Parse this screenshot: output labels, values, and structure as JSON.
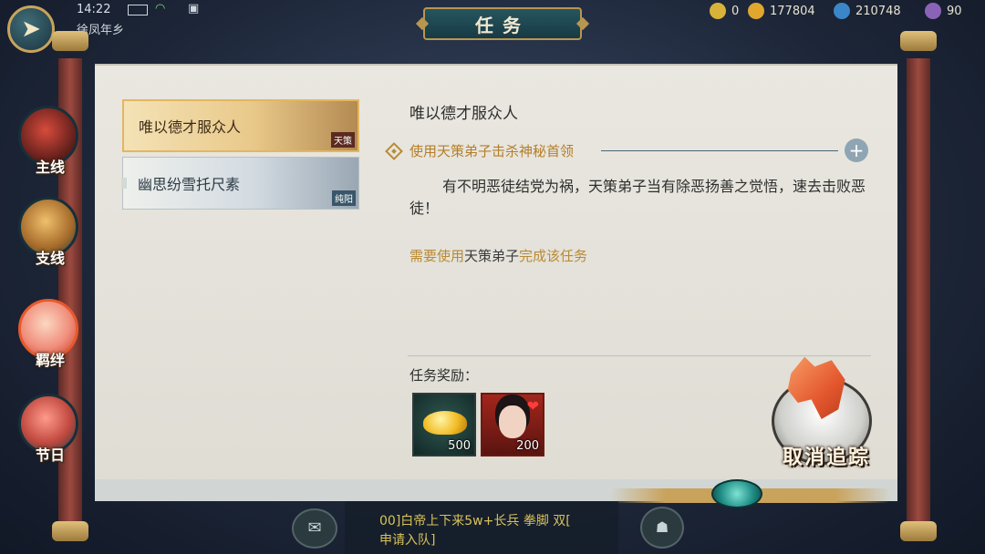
{
  "status": {
    "time": "14:22",
    "location": "徐凤年乡"
  },
  "resources": [
    {
      "name": "resource-1",
      "value": "0",
      "color": "#d9b23a"
    },
    {
      "name": "resource-2",
      "value": "177804",
      "color": "#e1a62e"
    },
    {
      "name": "resource-3",
      "value": "210748",
      "color": "#3b86c9"
    },
    {
      "name": "resource-4",
      "value": "90",
      "color": "#8a63b7"
    }
  ],
  "header": {
    "title": "任务"
  },
  "tabs": [
    {
      "id": "main",
      "label": "主线"
    },
    {
      "id": "side",
      "label": "支线"
    },
    {
      "id": "bond",
      "label": "羁绊"
    },
    {
      "id": "festival",
      "label": "节日"
    }
  ],
  "quests": [
    {
      "title": "唯以德才服众人",
      "sect": "天策",
      "selected": true
    },
    {
      "title": "幽思纷雪托尺素",
      "sect": "纯阳",
      "selected": false
    }
  ],
  "detail": {
    "title": "唯以德才服众人",
    "objective": "使用天策弟子击杀神秘首领",
    "description": "有不明恶徒结党为祸，天策弟子当有除恶扬善之觉悟，速去击败恶徒！",
    "require_prefix": "需要使用",
    "require_highlight": "天策弟子",
    "require_suffix": "完成该任务",
    "reward_label": "任务奖励：",
    "rewards": [
      {
        "type": "gold-ingot",
        "qty": "500"
      },
      {
        "type": "hero-portrait",
        "qty": "200"
      }
    ],
    "cancel_label": "取消追踪"
  },
  "chat": {
    "line1": "00]白帝上下来5w+长兵 拳脚 双[",
    "line2": "申请入队]"
  }
}
